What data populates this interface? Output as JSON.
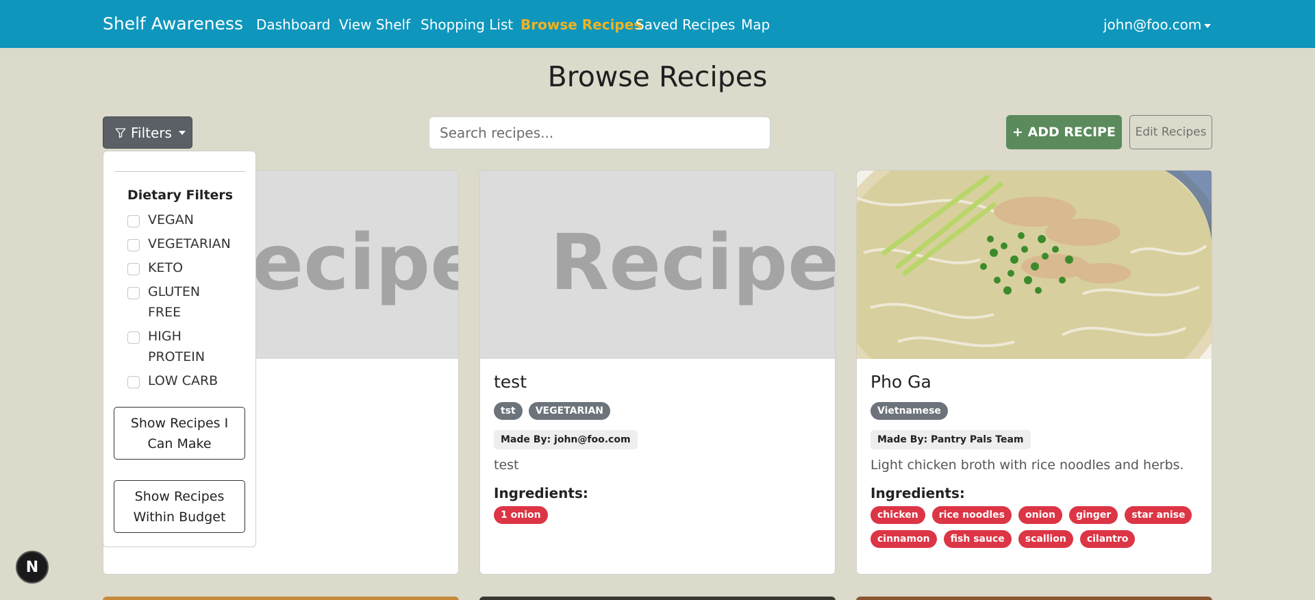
{
  "navbar": {
    "brand": "Shelf Awareness",
    "links": [
      "Dashboard",
      "View Shelf",
      "Shopping List",
      "Browse Recipes",
      "Saved Recipes",
      "Map"
    ],
    "active": "Browse Recipes",
    "user": "john@foo.com"
  },
  "page": {
    "title": "Browse Recipes"
  },
  "toolbar": {
    "filters_label": "Filters",
    "search_placeholder": "Search recipes...",
    "add_label": "+ ADD RECIPE",
    "edit_label": "Edit Recipes"
  },
  "filters": {
    "header": "Dietary Filters",
    "options": [
      "VEGAN",
      "VEGETARIAN",
      "KETO",
      "GLUTEN FREE",
      "HIGH PROTEIN",
      "LOW CARB"
    ],
    "btn_can_make": "Show Recipes I Can Make",
    "btn_budget": "Show Recipes Within Budget"
  },
  "cards": [
    {
      "placeholder": "Recipe"
    },
    {
      "placeholder": "Recipe",
      "title": "test",
      "tags": [
        "tst",
        "VEGETARIAN"
      ],
      "made_by": "Made By: john@foo.com",
      "description": "test",
      "ingredients_label": "Ingredients:",
      "ingredients": [
        "1 onion"
      ]
    },
    {
      "title": "Pho Ga",
      "tags": [
        "Vietnamese"
      ],
      "made_by": "Made By: Pantry Pals Team",
      "description": "Light chicken broth with rice noodles and herbs.",
      "ingredients_label": "Ingredients:",
      "ingredients": [
        "chicken",
        "rice noodles",
        "onion",
        "ginger",
        "star anise",
        "cinnamon",
        "fish sauce",
        "scallion",
        "cilantro"
      ]
    }
  ],
  "dev_badge": "N",
  "colors": {
    "navbar": "#0e96bd",
    "active_link": "#f0b323",
    "add_button": "#5b8a5c",
    "ingredient_pill": "#dc3545",
    "tag_badge": "#6d737a",
    "background": "#dcdacb"
  }
}
